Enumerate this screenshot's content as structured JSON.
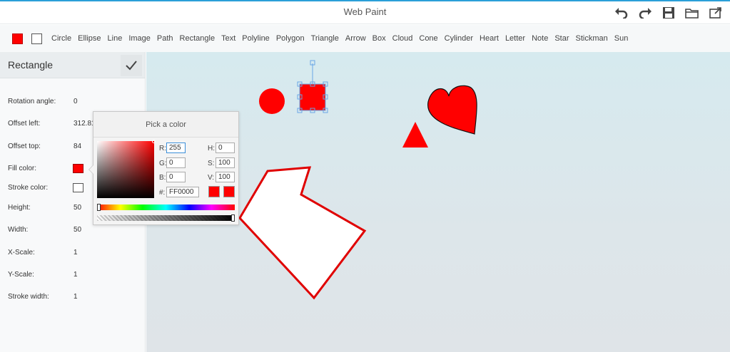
{
  "app": {
    "title": "Web Paint"
  },
  "titlebar": {
    "actions": [
      "undo-icon",
      "redo-icon",
      "save-icon",
      "open-folder-icon",
      "export-icon"
    ]
  },
  "toolbar": {
    "fill_color": "#ff0000",
    "stroke_color": "#ffffff",
    "tools": [
      "Circle",
      "Ellipse",
      "Line",
      "Image",
      "Path",
      "Rectangle",
      "Text",
      "Polyline",
      "Polygon",
      "Triangle",
      "Arrow",
      "Box",
      "Cloud",
      "Cone",
      "Cylinder",
      "Heart",
      "Letter",
      "Note",
      "Star",
      "Stickman",
      "Sun"
    ]
  },
  "panel": {
    "title": "Rectangle",
    "props": {
      "rotation_label": "Rotation angle:",
      "rotation_value": "0",
      "offset_left_label": "Offset left:",
      "offset_left_value": "312.81",
      "offset_top_label": "Offset top:",
      "offset_top_value": "84",
      "fill_label": "Fill color:",
      "fill_value": "#ff0000",
      "stroke_label": "Stroke color:",
      "stroke_value": "#ffffff",
      "height_label": "Height:",
      "height_value": "50",
      "width_label": "Width:",
      "width_value": "50",
      "xscale_label": "X-Scale:",
      "xscale_value": "1",
      "yscale_label": "Y-Scale:",
      "yscale_value": "1",
      "stroke_width_label": "Stroke width:",
      "stroke_width_value": "1"
    }
  },
  "picker": {
    "title": "Pick a color",
    "r_label": "R:",
    "r": "255",
    "g_label": "G:",
    "g": "0",
    "b_label": "B:",
    "b": "0",
    "h_label": "H:",
    "h": "0",
    "s_label": "S:",
    "s": "100",
    "v_label": "V:",
    "v": "100",
    "hex_label": "#:",
    "hex": "FF0000",
    "current_color": "#ff0000",
    "previous_color": "#ff0000"
  },
  "canvas": {
    "shapes": [
      "circle",
      "rectangle",
      "triangle",
      "heart",
      "arrow"
    ],
    "colors": {
      "shape_fill": "#ff0000",
      "arrow_fill": "#ffffff",
      "arrow_stroke": "#e00000",
      "selection": "#6aa6e6"
    }
  }
}
